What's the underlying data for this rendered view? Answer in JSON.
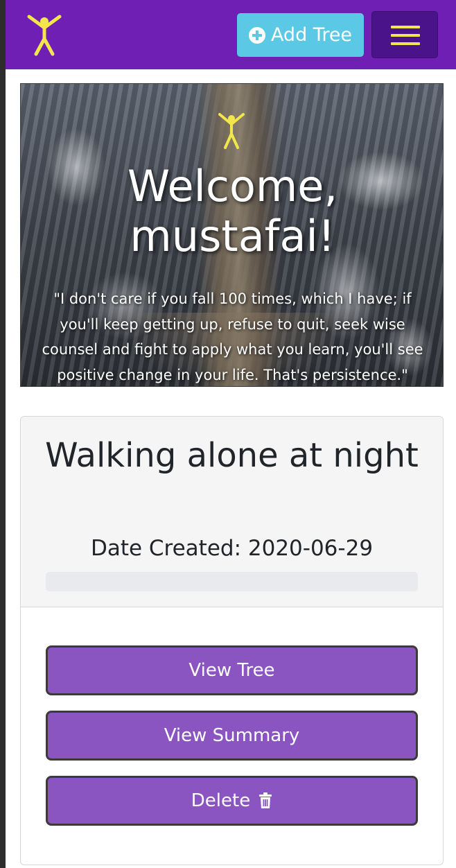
{
  "navbar": {
    "add_tree_label": "Add Tree",
    "brand_color": "#6f1fb3",
    "accent_yellow": "#f2e64a",
    "add_button_color": "#5bc8e5"
  },
  "hero": {
    "title": "Welcome, mustafai!",
    "quote": "\"I don't care if you fall 100 times, which I have; if you'll keep getting up, refuse to quit, seek wise counsel and fight to apply what you learn, you'll see positive change in your life. That's persistence.\""
  },
  "card": {
    "title": "Walking alone at night",
    "date": "Date Created: 2020-06-29",
    "progress_fraction": 0,
    "button_color": "#8a55c0",
    "buttons": {
      "view_tree": "View Tree",
      "view_summary": "View Summary",
      "delete": "Delete"
    }
  },
  "icons": {
    "brand": "person-figure-icon",
    "add": "plus-circle-icon",
    "menu": "hamburger-menu-icon",
    "delete": "trash-icon"
  }
}
